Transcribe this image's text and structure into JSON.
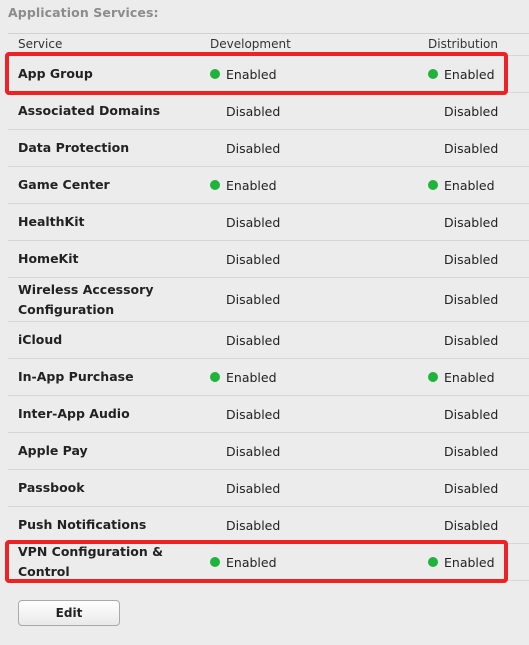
{
  "section_title": "Application Services:",
  "columns": {
    "service": "Service",
    "development": "Development",
    "distribution": "Distribution"
  },
  "services": [
    {
      "name": "App Group",
      "development": "Enabled",
      "distribution": "Enabled",
      "dev_enabled": true,
      "dist_enabled": true
    },
    {
      "name": "Associated Domains",
      "development": "Disabled",
      "distribution": "Disabled",
      "dev_enabled": false,
      "dist_enabled": false
    },
    {
      "name": "Data Protection",
      "development": "Disabled",
      "distribution": "Disabled",
      "dev_enabled": false,
      "dist_enabled": false
    },
    {
      "name": "Game Center",
      "development": "Enabled",
      "distribution": "Enabled",
      "dev_enabled": true,
      "dist_enabled": true
    },
    {
      "name": "HealthKit",
      "development": "Disabled",
      "distribution": "Disabled",
      "dev_enabled": false,
      "dist_enabled": false
    },
    {
      "name": "HomeKit",
      "development": "Disabled",
      "distribution": "Disabled",
      "dev_enabled": false,
      "dist_enabled": false
    },
    {
      "name": "Wireless Accessory Configuration",
      "development": "Disabled",
      "distribution": "Disabled",
      "dev_enabled": false,
      "dist_enabled": false
    },
    {
      "name": "iCloud",
      "development": "Disabled",
      "distribution": "Disabled",
      "dev_enabled": false,
      "dist_enabled": false
    },
    {
      "name": "In-App Purchase",
      "development": "Enabled",
      "distribution": "Enabled",
      "dev_enabled": true,
      "dist_enabled": true
    },
    {
      "name": "Inter-App Audio",
      "development": "Disabled",
      "distribution": "Disabled",
      "dev_enabled": false,
      "dist_enabled": false
    },
    {
      "name": "Apple Pay",
      "development": "Disabled",
      "distribution": "Disabled",
      "dev_enabled": false,
      "dist_enabled": false
    },
    {
      "name": "Passbook",
      "development": "Disabled",
      "distribution": "Disabled",
      "dev_enabled": false,
      "dist_enabled": false
    },
    {
      "name": "Push Notifications",
      "development": "Disabled",
      "distribution": "Disabled",
      "dev_enabled": false,
      "dist_enabled": false
    },
    {
      "name": "VPN Configuration & Control",
      "development": "Enabled",
      "distribution": "Enabled",
      "dev_enabled": true,
      "dist_enabled": true
    }
  ],
  "highlighted_services": [
    "App Group",
    "VPN Configuration & Control"
  ],
  "colors": {
    "enabled_dot": "#1fb33c",
    "highlight": "#ee2222",
    "background": "#ececec"
  },
  "edit_label": "Edit"
}
